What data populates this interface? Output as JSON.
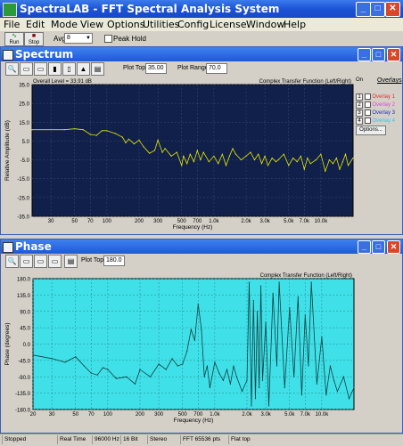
{
  "app": {
    "title": "SpectraLAB - FFT Spectral Analysis System"
  },
  "menu": [
    "File",
    "Edit",
    "Mode",
    "View",
    "Options",
    "Utilities",
    "Config",
    "License",
    "Window",
    "Help"
  ],
  "toolbar": {
    "run": "Run",
    "stop": "Stop",
    "avg_label": "Avg:",
    "avg_value": "8",
    "peak_hold": "Peak Hold"
  },
  "spectrum": {
    "title": "Spectrum",
    "plot_top_label": "Plot Top:",
    "plot_top": "35.00",
    "plot_range_label": "Plot Range:",
    "plot_range": "70.0",
    "overall_level": "Overall Level = 33.91 dB",
    "chart_title": "Complex Transfer Function (Left/Right)",
    "overlays_label": "Overlays",
    "on_label": "On",
    "overlays": [
      {
        "n": "1",
        "name": "Overlay 1",
        "color": "#e03030"
      },
      {
        "n": "2",
        "name": "Overlay 2",
        "color": "#d050d0"
      },
      {
        "n": "3",
        "name": "Overlay 3",
        "color": "#2030c0"
      },
      {
        "n": "4",
        "name": "Overlay 4",
        "color": "#30c8e0"
      }
    ],
    "options": "Options..."
  },
  "phase": {
    "title": "Phase",
    "plot_top_label": "Plot Top:",
    "plot_top": "180.0",
    "chart_title": "Complex Transfer Function (Left/Right)"
  },
  "status": [
    "Stopped",
    "Real Time",
    "96000 Hz",
    "16 Bit",
    "Stereo",
    "FFT 65536 pts",
    "Flat top"
  ],
  "chart_data": [
    {
      "type": "line",
      "title": "Complex Transfer Function (Left/Right)",
      "xlabel": "Frequency (Hz)",
      "ylabel": "Relative Amplitude (dB)",
      "xscale": "log",
      "xlim": [
        20,
        20000
      ],
      "ylim": [
        -35,
        35
      ],
      "xticks": [
        "30",
        "50",
        "70",
        "100",
        "200",
        "300",
        "500",
        "700",
        "1.0k",
        "2.0k",
        "3.0k",
        "5.0k",
        "7.0k",
        "10.0k"
      ],
      "yticks": [
        "35.0",
        "25.0",
        "15.0",
        "5.0",
        "-5.0",
        "-15.0",
        "-25.0",
        "-35.0"
      ],
      "grid": true,
      "background": "#10204a",
      "line_color": "#e8e800",
      "series": [
        {
          "x": [
            20,
            40,
            50,
            60,
            70,
            80,
            90,
            100,
            120,
            140,
            150,
            160,
            180,
            200,
            220,
            250,
            280,
            300,
            330,
            350,
            400,
            450,
            500,
            520,
            560,
            600,
            650,
            700,
            750,
            800,
            900,
            1000,
            1100,
            1200,
            1300,
            1400,
            1500,
            1600,
            1800,
            2000,
            2200,
            2400,
            2600,
            2800,
            3000,
            3200,
            3500,
            3800,
            4000,
            4500,
            5000,
            5500,
            6000,
            6500,
            7000,
            7500,
            8000,
            9000,
            10000,
            11000,
            12000,
            13000,
            14000,
            15000,
            16000,
            17000,
            18000,
            20000
          ],
          "values": [
            11,
            11,
            11.5,
            11,
            8.5,
            8,
            10.5,
            10.5,
            9,
            7,
            4,
            6,
            3.5,
            5.5,
            2,
            -1.5,
            0,
            5.5,
            -1,
            1,
            -3,
            -1,
            -8,
            -3,
            -7,
            -2,
            -6,
            0,
            -5,
            -1,
            -6,
            -3,
            -7,
            -2,
            -8,
            -3,
            1,
            -2,
            -5,
            -3,
            -1,
            -5,
            -2,
            -7,
            -3,
            -8,
            -4,
            -6,
            -5,
            -2,
            -8,
            -4,
            -6,
            -3,
            -10,
            -4,
            -7,
            -5,
            -2,
            -11,
            -5,
            -7,
            -4,
            -10,
            -6,
            -2,
            -8,
            -4
          ]
        }
      ]
    },
    {
      "type": "line",
      "title": "Complex Transfer Function (Left/Right)",
      "xlabel": "Frequency (Hz)",
      "ylabel": "Phase (degrees)",
      "xscale": "log",
      "xlim": [
        20,
        20000
      ],
      "ylim": [
        -180,
        180
      ],
      "xticks": [
        "20",
        "30",
        "50",
        "70",
        "100",
        "200",
        "300",
        "500",
        "700",
        "1.0k",
        "2.0k",
        "3.0k",
        "5.0k",
        "7.0k",
        "10.0k"
      ],
      "yticks": [
        "180.0",
        "135.0",
        "90.0",
        "45.0",
        "0.0",
        "-45.0",
        "-90.0",
        "-135.0",
        "-180.0"
      ],
      "grid": true,
      "background": "#40e0e8",
      "line_color": "#104040",
      "series": [
        {
          "x": [
            20,
            30,
            40,
            50,
            60,
            70,
            80,
            90,
            100,
            120,
            150,
            180,
            200,
            250,
            300,
            350,
            400,
            450,
            500,
            550,
            600,
            650,
            700,
            750,
            800,
            850,
            900,
            1000,
            1100,
            1200,
            1300,
            1400,
            1500,
            1600,
            1800,
            2000,
            2100,
            2200,
            2300,
            2400,
            2500,
            2600,
            2700,
            2800,
            3000,
            3200,
            3500,
            3800,
            4000,
            4500,
            5000,
            5500,
            6000,
            6500,
            7000,
            7500,
            8000,
            9000,
            10000,
            11000,
            12000,
            13000,
            14000,
            16000,
            18000,
            20000
          ],
          "values": [
            -30,
            -40,
            -50,
            -35,
            -60,
            -80,
            -85,
            -65,
            -70,
            -95,
            -90,
            -110,
            -70,
            -90,
            -55,
            -70,
            -40,
            -60,
            -55,
            -20,
            40,
            10,
            110,
            40,
            -90,
            -60,
            -120,
            -50,
            -80,
            -100,
            -70,
            -110,
            -60,
            -90,
            -130,
            -100,
            170,
            -170,
            120,
            -150,
            90,
            -120,
            160,
            -100,
            60,
            -170,
            140,
            -60,
            170,
            -120,
            100,
            -90,
            130,
            -140,
            80,
            -60,
            170,
            -110,
            20,
            -140,
            -60,
            -100,
            -130,
            -90,
            -150,
            -120
          ]
        }
      ]
    }
  ]
}
